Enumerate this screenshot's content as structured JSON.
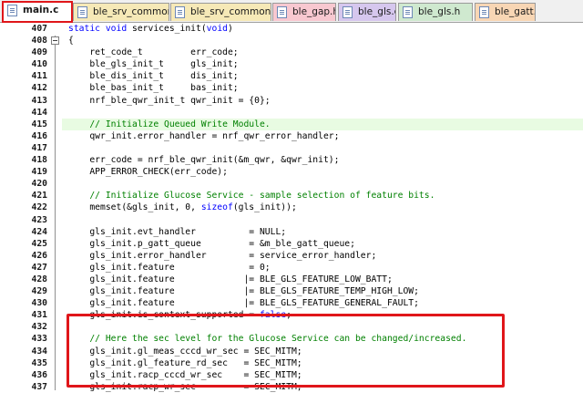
{
  "tabs": [
    {
      "label": "main.c",
      "color": "#ffffff",
      "left": 0
    },
    {
      "label": "ble_srv_common.h",
      "color": "#f6e9b7"
    },
    {
      "label": "ble_srv_common.c",
      "color": "#f6e9b7"
    },
    {
      "label": "ble_gap.h",
      "color": "#f8c8d0"
    },
    {
      "label": "ble_gls.c",
      "color": "#d6c7ee"
    },
    {
      "label": "ble_gls.h",
      "color": "#cfe9cf"
    },
    {
      "label": "ble_gatt.h",
      "color": "#f8d6b4"
    }
  ],
  "lines": [
    {
      "n": "407",
      "parts": [
        {
          "t": "static void ",
          "c": "kw"
        },
        {
          "t": "services_init("
        },
        {
          "t": "void",
          "c": "kw"
        },
        {
          "t": ")"
        }
      ]
    },
    {
      "n": "408",
      "parts": [
        {
          "t": "{"
        }
      ]
    },
    {
      "n": "409",
      "parts": [
        {
          "t": "    ret_code_t         err_code;"
        }
      ]
    },
    {
      "n": "410",
      "parts": [
        {
          "t": "    ble_gls_init_t     gls_init;"
        }
      ]
    },
    {
      "n": "411",
      "parts": [
        {
          "t": "    ble_dis_init_t     dis_init;"
        }
      ]
    },
    {
      "n": "412",
      "parts": [
        {
          "t": "    ble_bas_init_t     bas_init;"
        }
      ]
    },
    {
      "n": "413",
      "parts": [
        {
          "t": "    nrf_ble_qwr_init_t qwr_init = {0};"
        }
      ]
    },
    {
      "n": "414",
      "parts": [
        {
          "t": ""
        }
      ]
    },
    {
      "n": "415",
      "hl": true,
      "parts": [
        {
          "t": "    // Initialize Queued Write Module.",
          "c": "cm"
        }
      ]
    },
    {
      "n": "416",
      "parts": [
        {
          "t": "    qwr_init.error_handler = nrf_qwr_error_handler;"
        }
      ]
    },
    {
      "n": "417",
      "parts": [
        {
          "t": ""
        }
      ]
    },
    {
      "n": "418",
      "parts": [
        {
          "t": "    err_code = nrf_ble_qwr_init(&m_qwr, &qwr_init);"
        }
      ]
    },
    {
      "n": "419",
      "parts": [
        {
          "t": "    APP_ERROR_CHECK(err_code);"
        }
      ]
    },
    {
      "n": "420",
      "parts": [
        {
          "t": ""
        }
      ]
    },
    {
      "n": "421",
      "parts": [
        {
          "t": "    // Initialize Glucose Service - sample selection of feature bits.",
          "c": "cm"
        }
      ]
    },
    {
      "n": "422",
      "parts": [
        {
          "t": "    memset(&gls_init, 0, "
        },
        {
          "t": "sizeof",
          "c": "kw"
        },
        {
          "t": "(gls_init));"
        }
      ]
    },
    {
      "n": "423",
      "parts": [
        {
          "t": ""
        }
      ]
    },
    {
      "n": "424",
      "parts": [
        {
          "t": "    gls_init.evt_handler          = NULL;"
        }
      ]
    },
    {
      "n": "425",
      "parts": [
        {
          "t": "    gls_init.p_gatt_queue         = &m_ble_gatt_queue;"
        }
      ]
    },
    {
      "n": "426",
      "parts": [
        {
          "t": "    gls_init.error_handler        = service_error_handler;"
        }
      ]
    },
    {
      "n": "427",
      "parts": [
        {
          "t": "    gls_init.feature              = 0;"
        }
      ]
    },
    {
      "n": "428",
      "parts": [
        {
          "t": "    gls_init.feature             |= BLE_GLS_FEATURE_LOW_BATT;"
        }
      ]
    },
    {
      "n": "429",
      "parts": [
        {
          "t": "    gls_init.feature             |= BLE_GLS_FEATURE_TEMP_HIGH_LOW;"
        }
      ]
    },
    {
      "n": "430",
      "parts": [
        {
          "t": "    gls_init.feature             |= BLE_GLS_FEATURE_GENERAL_FAULT;"
        }
      ]
    },
    {
      "n": "431",
      "parts": [
        {
          "t": "    gls_init.is_context_supported = "
        },
        {
          "t": "false",
          "c": "kw"
        },
        {
          "t": ";"
        }
      ]
    },
    {
      "n": "432",
      "parts": [
        {
          "t": ""
        }
      ]
    },
    {
      "n": "433",
      "parts": [
        {
          "t": "    // Here the sec level for the Glucose Service can be changed/increased.",
          "c": "cm"
        }
      ]
    },
    {
      "n": "434",
      "parts": [
        {
          "t": "    gls_init.gl_meas_cccd_wr_sec = SEC_MITM;"
        }
      ]
    },
    {
      "n": "435",
      "parts": [
        {
          "t": "    gls_init.gl_feature_rd_sec   = SEC_MITM;"
        }
      ]
    },
    {
      "n": "436",
      "parts": [
        {
          "t": "    gls_init.racp_cccd_wr_sec    = SEC_MITM;"
        }
      ]
    },
    {
      "n": "437",
      "parts": [
        {
          "t": "    gls_init.racp_wr_sec         = SEC_MITM;"
        }
      ]
    }
  ]
}
